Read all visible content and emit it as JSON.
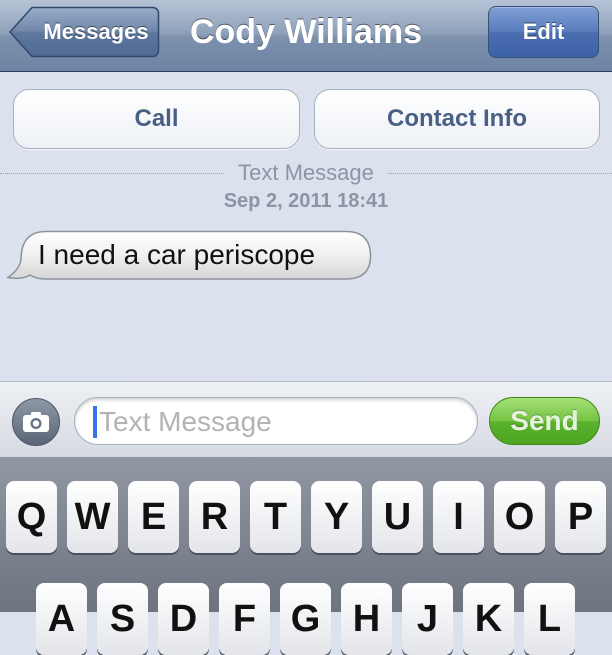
{
  "navbar": {
    "back_label": "Messages",
    "title": "Cody Williams",
    "edit_label": "Edit"
  },
  "actions": {
    "call_label": "Call",
    "contact_label": "Contact Info"
  },
  "thread": {
    "separator_label": "Text Message",
    "timestamp": "Sep 2, 2011 18:41",
    "messages": [
      {
        "direction": "incoming",
        "text": "I need a car periscope"
      }
    ]
  },
  "composer": {
    "camera_icon": "camera-icon",
    "placeholder": "Text Message",
    "value": "",
    "send_label": "Send"
  },
  "keyboard": {
    "row1": [
      "Q",
      "W",
      "E",
      "R",
      "T",
      "Y",
      "U",
      "I",
      "O",
      "P"
    ],
    "row2": [
      "A",
      "S",
      "D",
      "F",
      "G",
      "H",
      "J",
      "K",
      "L"
    ]
  },
  "colors": {
    "navbar": "#7d91ad",
    "edit_button": "#4a6db0",
    "send_button": "#5ab12c",
    "background": "#dbe2ed"
  }
}
